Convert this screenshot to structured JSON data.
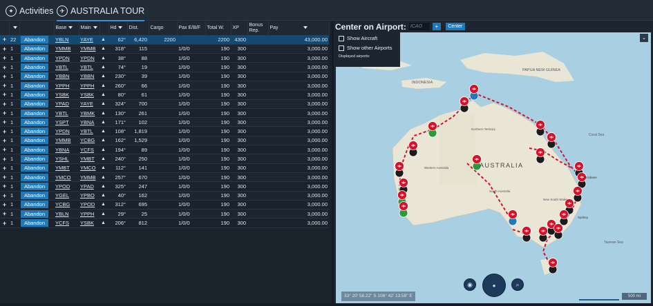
{
  "tabs": [
    {
      "label": "Activities",
      "icon": "activities-icon"
    },
    {
      "label": "AUSTRALIA TOUR",
      "icon": "tour-icon"
    }
  ],
  "table": {
    "headers": {
      "base": "Base",
      "main": "Main",
      "hd": "Hd",
      "dist": "Dist.",
      "cargo": "Cargo",
      "pax": "Pax E/B/F",
      "total": "Total W.",
      "xp": "XP",
      "bonus": "Bonus Rep.",
      "pay": "Pay"
    },
    "abandon_label": "Abandon",
    "rows": [
      {
        "n": "22",
        "base": "YBLN",
        "main": "YAYE",
        "hd": "62°",
        "dist": "6,420",
        "cargo": "2200",
        "pax": "",
        "total": "2200",
        "xp": "4300",
        "bonus": "",
        "pay": "43,000.00"
      },
      {
        "n": "1",
        "base": "YMMB",
        "main": "YMMB",
        "hd": "318°",
        "dist": "115",
        "cargo": "",
        "pax": "1/0/0",
        "total": "190",
        "xp": "300",
        "bonus": "",
        "pay": "3,000.00"
      },
      {
        "n": "1",
        "base": "YPDN",
        "main": "YPDN",
        "hd": "38°",
        "dist": "88",
        "cargo": "",
        "pax": "1/0/0",
        "total": "190",
        "xp": "300",
        "bonus": "",
        "pay": "3,000.00"
      },
      {
        "n": "1",
        "base": "YBTL",
        "main": "YBTL",
        "hd": "74°",
        "dist": "19",
        "cargo": "",
        "pax": "1/0/0",
        "total": "190",
        "xp": "300",
        "bonus": "",
        "pay": "3,000.00"
      },
      {
        "n": "1",
        "base": "YBBN",
        "main": "YBBN",
        "hd": "230°",
        "dist": "39",
        "cargo": "",
        "pax": "1/0/0",
        "total": "190",
        "xp": "300",
        "bonus": "",
        "pay": "3,000.00"
      },
      {
        "n": "1",
        "base": "YPPH",
        "main": "YPPH",
        "hd": "260°",
        "dist": "66",
        "cargo": "",
        "pax": "1/0/0",
        "total": "190",
        "xp": "300",
        "bonus": "",
        "pay": "3,000.00"
      },
      {
        "n": "1",
        "base": "YSBK",
        "main": "YSBK",
        "hd": "80°",
        "dist": "61",
        "cargo": "",
        "pax": "1/0/0",
        "total": "190",
        "xp": "300",
        "bonus": "",
        "pay": "3,000.00"
      },
      {
        "n": "1",
        "base": "YPAD",
        "main": "YAYE",
        "hd": "324°",
        "dist": "700",
        "cargo": "",
        "pax": "1/0/0",
        "total": "190",
        "xp": "300",
        "bonus": "",
        "pay": "3,000.00"
      },
      {
        "n": "1",
        "base": "YBTL",
        "main": "YBMK",
        "hd": "130°",
        "dist": "261",
        "cargo": "",
        "pax": "1/0/0",
        "total": "190",
        "xp": "300",
        "bonus": "",
        "pay": "3,000.00"
      },
      {
        "n": "1",
        "base": "YSPT",
        "main": "YBNA",
        "hd": "171°",
        "dist": "102",
        "cargo": "",
        "pax": "1/0/0",
        "total": "190",
        "xp": "300",
        "bonus": "",
        "pay": "3,000.00"
      },
      {
        "n": "1",
        "base": "YPDN",
        "main": "YBTL",
        "hd": "108°",
        "dist": "1,819",
        "cargo": "",
        "pax": "1/0/0",
        "total": "190",
        "xp": "300",
        "bonus": "",
        "pay": "3,000.00"
      },
      {
        "n": "1",
        "base": "YMMB",
        "main": "YCBG",
        "hd": "162°",
        "dist": "1,529",
        "cargo": "",
        "pax": "1/0/0",
        "total": "190",
        "xp": "300",
        "bonus": "",
        "pay": "3,000.00"
      },
      {
        "n": "1",
        "base": "YBNA",
        "main": "YCFS",
        "hd": "194°",
        "dist": "89",
        "cargo": "",
        "pax": "1/0/0",
        "total": "190",
        "xp": "300",
        "bonus": "",
        "pay": "3,000.00"
      },
      {
        "n": "1",
        "base": "YSHL",
        "main": "YMBT",
        "hd": "240°",
        "dist": "250",
        "cargo": "",
        "pax": "1/0/0",
        "total": "190",
        "xp": "300",
        "bonus": "",
        "pay": "3,000.00"
      },
      {
        "n": "1",
        "base": "YMBT",
        "main": "YMCO",
        "hd": "112°",
        "dist": "141",
        "cargo": "",
        "pax": "1/0/0",
        "total": "190",
        "xp": "300",
        "bonus": "",
        "pay": "3,000.00"
      },
      {
        "n": "1",
        "base": "YMCO",
        "main": "YMMB",
        "hd": "257°",
        "dist": "670",
        "cargo": "",
        "pax": "1/0/0",
        "total": "190",
        "xp": "300",
        "bonus": "",
        "pay": "3,000.00"
      },
      {
        "n": "1",
        "base": "YPOD",
        "main": "YPAD",
        "hd": "325°",
        "dist": "247",
        "cargo": "",
        "pax": "1/0/0",
        "total": "190",
        "xp": "300",
        "bonus": "",
        "pay": "3,000.00"
      },
      {
        "n": "1",
        "base": "YGEL",
        "main": "YPBO",
        "hd": "40°",
        "dist": "162",
        "cargo": "",
        "pax": "1/0/0",
        "total": "190",
        "xp": "300",
        "bonus": "",
        "pay": "3,000.00"
      },
      {
        "n": "1",
        "base": "YCBG",
        "main": "YPOD",
        "hd": "312°",
        "dist": "695",
        "cargo": "",
        "pax": "1/0/0",
        "total": "190",
        "xp": "300",
        "bonus": "",
        "pay": "3,000.00"
      },
      {
        "n": "1",
        "base": "YBLN",
        "main": "YPPH",
        "hd": "29°",
        "dist": "25",
        "cargo": "",
        "pax": "1/0/0",
        "total": "190",
        "xp": "300",
        "bonus": "",
        "pay": "3,000.00"
      },
      {
        "n": "1",
        "base": "YCFS",
        "main": "YSBK",
        "hd": "206°",
        "dist": "812",
        "cargo": "",
        "pax": "1/0/0",
        "total": "190",
        "xp": "300",
        "bonus": "",
        "pay": "3,000.00"
      }
    ]
  },
  "map": {
    "title": "Center on Airport:",
    "icao_placeholder": "ICAO",
    "add_label": "+",
    "center_label": "Center",
    "show_aircraft": "Show Aircraft",
    "show_other": "Show other Airports",
    "displayed": "Displayed airports:",
    "coords": "33° 20' 58.22\" S 106° 42' 13.59\" E",
    "scale": "500 mi",
    "labels": {
      "indonesia": "INDONESIA",
      "png": "PAPUA NEW GUINEA",
      "australia": "AUSTRALIA",
      "nt": "Northern Territory",
      "wa": "Western Australia",
      "sa": "South Australia",
      "nsw": "New South Wales",
      "coral": "Coral Sea",
      "tasman": "Tasman Sea",
      "sydney": "Sydney",
      "brisbane": "Brisbane"
    },
    "colors": {
      "ocean": "#a9cfe3",
      "land": "#e9e6d6",
      "route": "#d8102a",
      "pin": "#d8102a"
    }
  }
}
